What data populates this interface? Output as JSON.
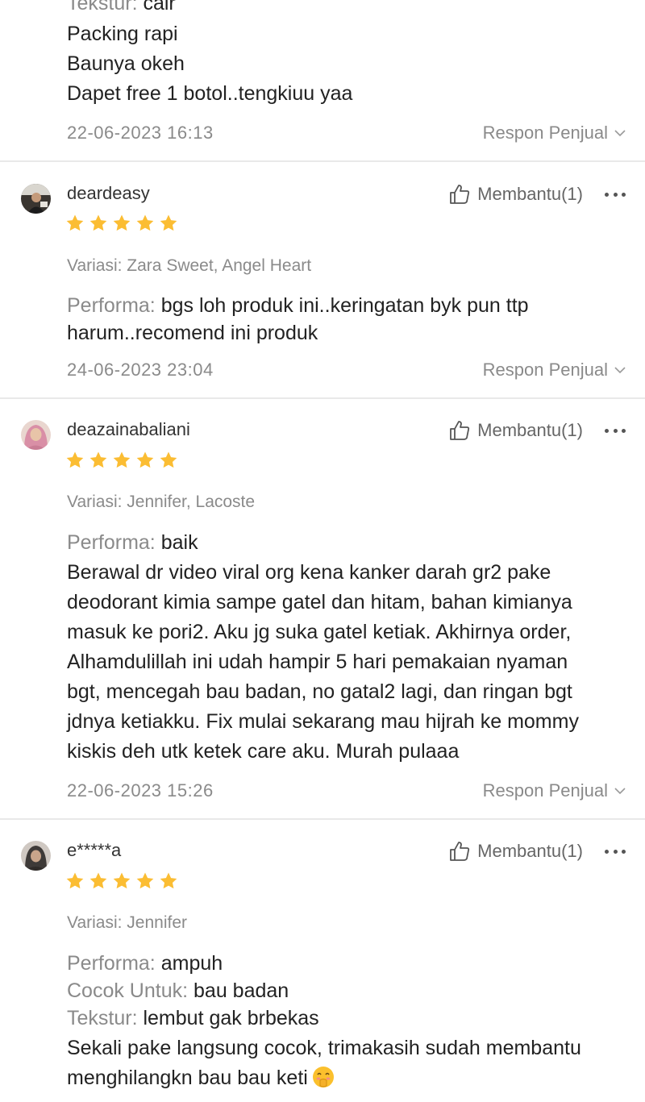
{
  "colors": {
    "star": "#fbbd33",
    "muted": "#8a8a8a",
    "divider": "#e9e9e9"
  },
  "reviews": [
    {
      "lines": [
        {
          "label": "Tekstur:",
          "text": " cair"
        },
        {
          "text": "Packing rapi"
        },
        {
          "text": "Baunya okeh"
        },
        {
          "text": "Dapet free 1 botol..tengkiuu yaa"
        }
      ],
      "date": "22-06-2023 16:13",
      "respon": "Respon Penjual"
    },
    {
      "username": "deardeasy",
      "helpful": "Membantu(1)",
      "rating": 5,
      "variasi": "Variasi: Zara Sweet, Angel Heart",
      "lines": [
        {
          "label": "Performa:",
          "text": " bgs loh produk ini..keringatan byk pun ttp"
        },
        {
          "text": "harum..recomend ini produk"
        }
      ],
      "date": "24-06-2023 23:04",
      "respon": "Respon Penjual"
    },
    {
      "username": "deazainabaliani",
      "helpful": "Membantu(1)",
      "rating": 5,
      "variasi": "Variasi: Jennifer, Lacoste",
      "lines": [
        {
          "label": "Performa:",
          "text": " baik"
        },
        {
          "text": "Berawal dr video viral org kena kanker darah gr2 pake"
        },
        {
          "text": "deodorant kimia sampe gatel dan hitam, bahan kimianya"
        },
        {
          "text": "masuk ke pori2. Aku jg suka gatel ketiak. Akhirnya order,"
        },
        {
          "text": "Alhamdulillah ini udah hampir 5 hari pemakaian nyaman"
        },
        {
          "text": "bgt, mencegah bau badan, no gatal2 lagi, dan ringan bgt"
        },
        {
          "text": "jdnya ketiakku. Fix mulai sekarang mau hijrah ke mommy"
        },
        {
          "text": "kiskis deh utk ketek care aku. Murah pulaaa"
        }
      ],
      "date": "22-06-2023 15:26",
      "respon": "Respon Penjual"
    },
    {
      "username": "e*****a",
      "helpful": "Membantu(1)",
      "rating": 5,
      "variasi": "Variasi: Jennifer",
      "lines": [
        {
          "label": "Performa:",
          "text": " ampuh"
        },
        {
          "label": "Cocok Untuk:",
          "text": " bau badan"
        },
        {
          "label": "Tekstur:",
          "text": " lembut gak brbekas"
        },
        {
          "text": "Sekali pake langsung cocok, trimakasih sudah membantu"
        },
        {
          "text": "menghilangkn bau bau keti"
        }
      ]
    }
  ]
}
